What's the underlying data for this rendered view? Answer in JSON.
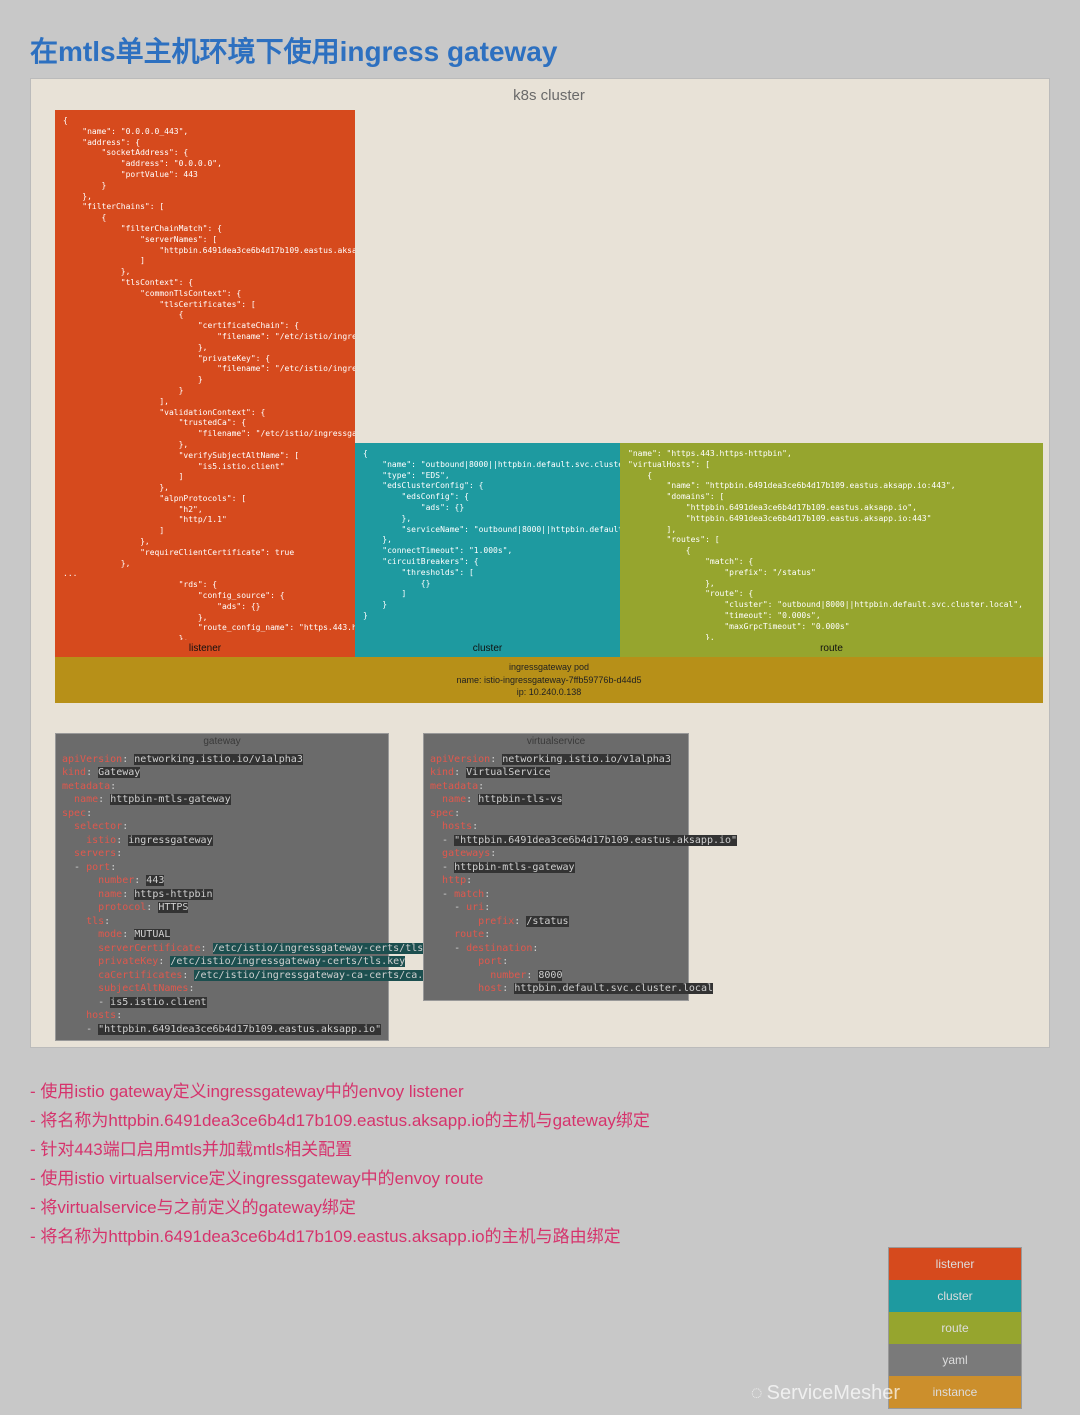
{
  "title": "在mtls单主机环境下使用ingress gateway",
  "cluster_label": "k8s cluster",
  "listener_json": "{\n    \"name\": \"0.0.0.0_443\",\n    \"address\": {\n        \"socketAddress\": {\n            \"address\": \"0.0.0.0\",\n            \"portValue\": 443\n        }\n    },\n    \"filterChains\": [\n        {\n            \"filterChainMatch\": {\n                \"serverNames\": [\n                    \"httpbin.6491dea3ce6b4d17b109.eastus.aksapp.io\"\n                ]\n            },\n            \"tlsContext\": {\n                \"commonTlsContext\": {\n                    \"tlsCertificates\": [\n                        {\n                            \"certificateChain\": {\n                                \"filename\": \"/etc/istio/ingressgateway-certs/tls.crt\"\n                            },\n                            \"privateKey\": {\n                                \"filename\": \"/etc/istio/ingressgateway-certs/tls.key\"\n                            }\n                        }\n                    ],\n                    \"validationContext\": {\n                        \"trustedCa\": {\n                            \"filename\": \"/etc/istio/ingressgateway-ca-certs/ca.crt\"\n                        },\n                        \"verifySubjectAltName\": [\n                            \"is5.istio.client\"\n                        ]\n                    },\n                    \"alpnProtocols\": [\n                        \"h2\",\n                        \"http/1.1\"\n                    ]\n                },\n                \"requireClientCertificate\": true\n            },\n...\n                        \"rds\": {\n                            \"config_source\": {\n                                \"ads\": {}\n                            },\n                            \"route_config_name\": \"https.443.https-httpbin\"\n                        },",
  "cluster_json": "{\n    \"name\": \"outbound|8000||httpbin.default.svc.cluster.local\",\n    \"type\": \"EDS\",\n    \"edsClusterConfig\": {\n        \"edsConfig\": {\n            \"ads\": {}\n        },\n        \"serviceName\": \"outbound|8000||httpbin.default.svc.cluster.local\"\n    },\n    \"connectTimeout\": \"1.000s\",\n    \"circuitBreakers\": {\n        \"thresholds\": [\n            {}\n        ]\n    }\n}",
  "route_json": "\"name\": \"https.443.https-httpbin\",\n\"virtualHosts\": [\n    {\n        \"name\": \"httpbin.6491dea3ce6b4d17b109.eastus.aksapp.io:443\",\n        \"domains\": [\n            \"httpbin.6491dea3ce6b4d17b109.eastus.aksapp.io\",\n            \"httpbin.6491dea3ce6b4d17b109.eastus.aksapp.io:443\"\n        ],\n        \"routes\": [\n            {\n                \"match\": {\n                    \"prefix\": \"/status\"\n                },\n                \"route\": {\n                    \"cluster\": \"outbound|8000||httpbin.default.svc.cluster.local\",\n                    \"timeout\": \"0.000s\",\n                    \"maxGrpcTimeout\": \"0.000s\"\n                },",
  "bands": {
    "listener": "listener",
    "cluster": "cluster",
    "route": "route"
  },
  "pod": {
    "l1": "ingressgateway pod",
    "l2": "name: istio-ingressgateway-7ffb59776b-d44d5",
    "l3": "ip: 10.240.0.138"
  },
  "yaml": {
    "gateway_title": "gateway",
    "vs_title": "virtualservice",
    "gateway": {
      "apiVersion": "networking.istio.io/v1alpha3",
      "kind": "Gateway",
      "metadata_name": "httpbin-mtls-gateway",
      "selector_istio": "ingressgateway",
      "port_number": "443",
      "port_name": "https-httpbin",
      "port_protocol": "HTTPS",
      "tls_mode": "MUTUAL",
      "serverCertificate": "/etc/istio/ingressgateway-certs/tls.crt",
      "privateKey": "/etc/istio/ingressgateway-certs/tls.key",
      "caCertificates": "/etc/istio/ingressgateway-ca-certs/ca.crt",
      "subjectAltName": "is5.istio.client",
      "host": "\"httpbin.6491dea3ce6b4d17b109.eastus.aksapp.io\""
    },
    "vs": {
      "apiVersion": "networking.istio.io/v1alpha3",
      "kind": "VirtualService",
      "metadata_name": "httpbin-tls-vs",
      "host": "\"httpbin.6491dea3ce6b4d17b109.eastus.aksapp.io\"",
      "gateway": "httpbin-mtls-gateway",
      "prefix": "/status",
      "dest_port": "8000",
      "dest_host": "httpbin.default.svc.cluster.local"
    }
  },
  "notes": [
    "使用istio gateway定义ingressgateway中的envoy listener",
    "将名称为httpbin.6491dea3ce6b4d17b109.eastus.aksapp.io的主机与gateway绑定",
    "针对443端口启用mtls并加载mtls相关配置",
    "使用istio virtualservice定义ingressgateway中的envoy route",
    "将virtualservice与之前定义的gateway绑定",
    "将名称为httpbin.6491dea3ce6b4d17b109.eastus.aksapp.io的主机与路由绑定"
  ],
  "legend": {
    "listener": "listener",
    "cluster": "cluster",
    "route": "route",
    "yaml": "yaml",
    "instance": "instance"
  },
  "watermark": "ServiceMesher"
}
